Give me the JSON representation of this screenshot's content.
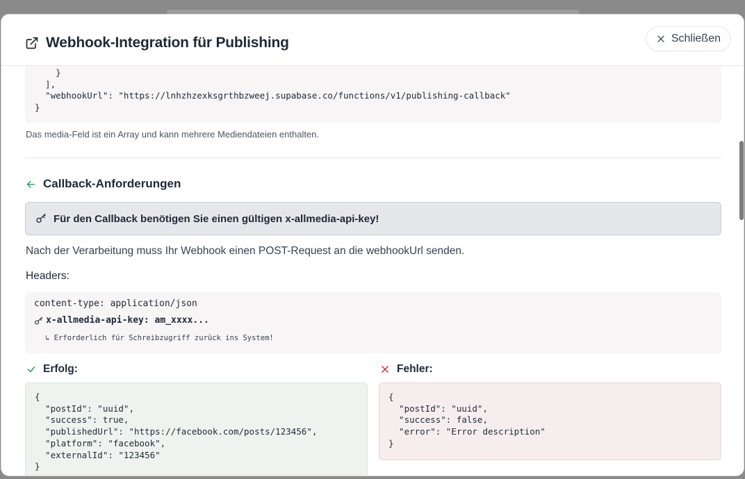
{
  "dialog": {
    "title": "Webhook-Integration für Publishing",
    "close_label": "Schließen"
  },
  "payload_example": {
    "code": "    }\n  ],\n  \"webhookUrl\": \"https://lnhzhzexksgrthbzweej.supabase.co/functions/v1/publishing-callback\"\n}",
    "note": "Das media-Feld ist ein Array und kann mehrere Mediendateien enthalten."
  },
  "callback": {
    "title": "Callback-Anforderungen",
    "alert": "Für den Callback benötigen Sie einen gültigen x-allmedia-api-key!",
    "description": "Nach der Verarbeitung muss Ihr Webhook einen POST-Request an die webhookUrl senden.",
    "headers_label": "Headers:",
    "headers": {
      "content_type": "content-type: application/json",
      "api_key": "x-allmedia-api-key: am_xxxx...",
      "api_key_note": "↳ Erforderlich für Schreibzugriff zurück ins System!"
    },
    "success": {
      "label": "Erfolg:",
      "code": "{\n  \"postId\": \"uuid\",\n  \"success\": true,\n  \"publishedUrl\": \"https://facebook.com/posts/123456\",\n  \"platform\": \"facebook\",\n  \"externalId\": \"123456\"\n}"
    },
    "error": {
      "label": "Fehler:",
      "code": "{\n  \"postId\": \"uuid\",\n  \"success\": false,\n  \"error\": \"Error description\"\n}"
    }
  },
  "colors": {
    "success": "#16a34a",
    "error": "#dc2626",
    "accent_arrow": "#16a34a"
  },
  "icons": {
    "title": "external-link-icon",
    "close": "close-icon",
    "section": "arrow-left-icon",
    "key": "key-icon",
    "success": "check-icon",
    "error": "x-icon"
  }
}
